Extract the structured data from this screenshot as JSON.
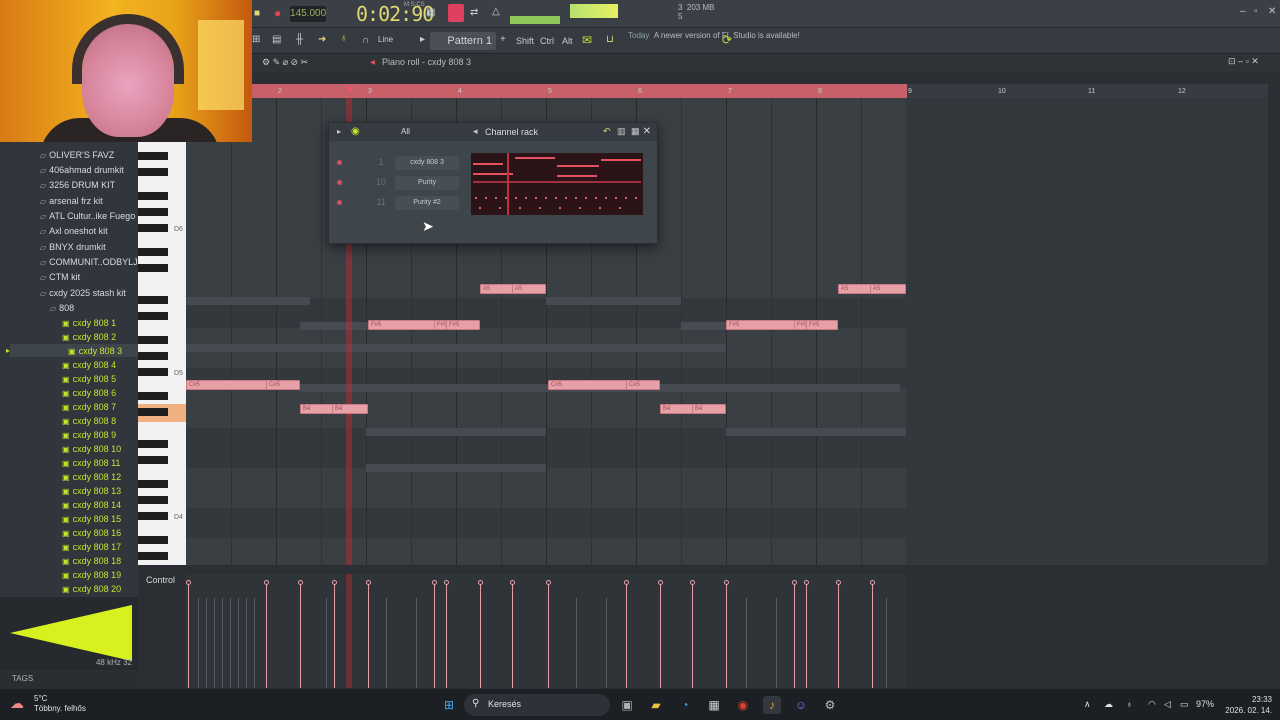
{
  "transport": {
    "tempo": "145.000",
    "time": "0:02:90",
    "time_unit": "M:S:CS",
    "pattern": "Pattern 1",
    "snap": "Line",
    "modifiers": [
      "Shift",
      "Ctrl",
      "Alt"
    ],
    "news_today": "Today",
    "news_text": "A newer version of FL Studio is available!",
    "memory": "203 MB",
    "cpu_a": "3",
    "cpu_b": "5",
    "window_controls": [
      "–",
      "▫",
      "✕"
    ]
  },
  "piano_roll": {
    "title": "Piano roll - cxdy 808 3",
    "bars": [
      "2",
      "3",
      "4",
      "5",
      "6",
      "7",
      "8",
      "9",
      "10",
      "11",
      "12"
    ],
    "key_labels": [
      "D6",
      "D5",
      "D4"
    ],
    "notes": [
      {
        "label": "A5",
        "label2": "A5",
        "pitch_row": 0
      },
      {
        "label": "F#5",
        "label2": "F#5",
        "label3": "F#5",
        "pitch_row": 1
      },
      {
        "label": "C#5",
        "label2": "C#5",
        "pitch_row": 2
      },
      {
        "label": "B4",
        "label2": "B4",
        "pitch_row": 3
      }
    ],
    "control_label": "Control"
  },
  "channel_rack": {
    "title": "Channel rack",
    "filter": "All",
    "channels": [
      {
        "num": "1",
        "name": "cxdy 808 3"
      },
      {
        "num": "10",
        "name": "Purity"
      },
      {
        "num": "11",
        "name": "Purity #2"
      }
    ]
  },
  "browser": {
    "folders": [
      "OLIVER'S FAVZ",
      "406ahmad drumkit",
      "3256 DRUM KIT",
      "arsenal frz kit",
      "ATL Cultur..ike Fuego",
      "Axl oneshot kit",
      "BNYX drumkit",
      "COMMUNIT..ODBYLJS",
      "CTM kit",
      "cxdy 2025 stash kit"
    ],
    "subfolder": "808",
    "samples": [
      "cxdy 808 1",
      "cxdy 808 2",
      "cxdy 808 3",
      "cxdy 808 4",
      "cxdy 808 5",
      "cxdy 808 6",
      "cxdy 808 7",
      "cxdy 808 8",
      "cxdy 808 9",
      "cxdy 808 10",
      "cxdy 808 11",
      "cxdy 808 12",
      "cxdy 808 13",
      "cxdy 808 14",
      "cxdy 808 15",
      "cxdy 808 16",
      "cxdy 808 17",
      "cxdy 808 18",
      "cxdy 808 19",
      "cxdy 808 20"
    ],
    "sample_rate": "48 kHz 32",
    "tags_label": "TAGS"
  },
  "taskbar": {
    "temperature": "5°C",
    "weather": "Többny. felhős",
    "search_placeholder": "Keresés",
    "battery": "97%",
    "time": "23:33",
    "date": "2026. 02. 14."
  },
  "colors": {
    "note": "#e8a0a8",
    "accent_lime": "#c8e030",
    "playhead": "#c82832"
  }
}
